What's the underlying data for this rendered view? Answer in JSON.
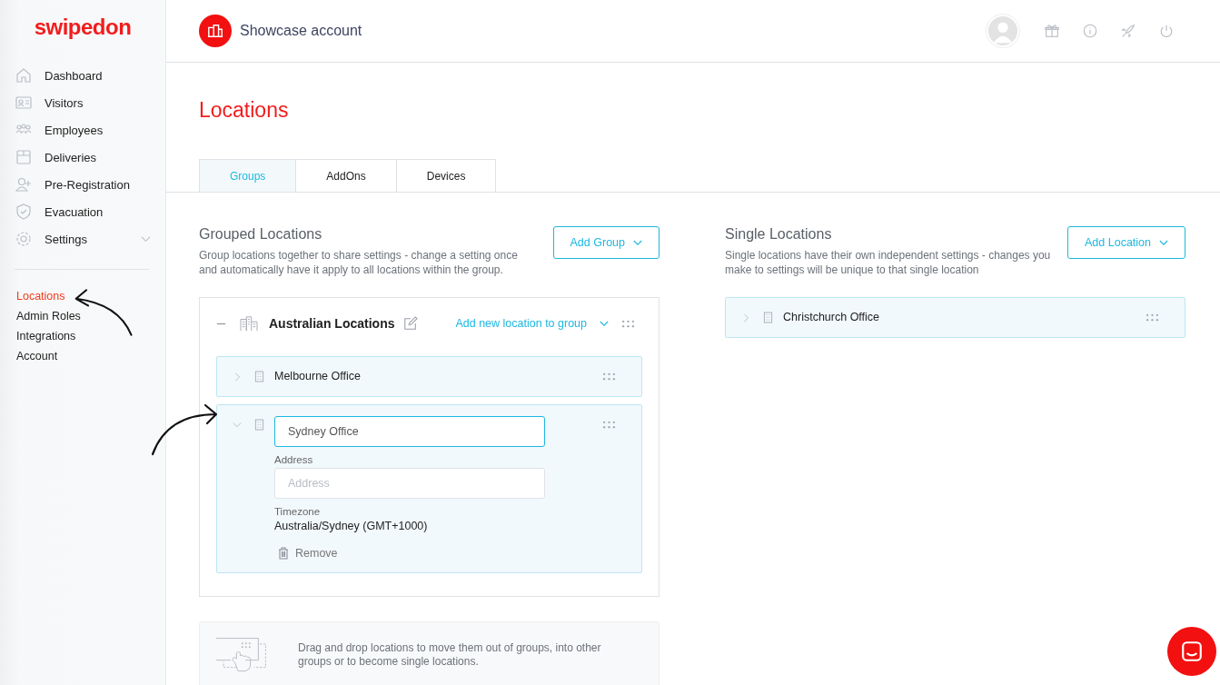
{
  "logo": "swipedon",
  "nav": [
    {
      "label": "Dashboard",
      "has_submenu": false
    },
    {
      "label": "Visitors",
      "has_submenu": false
    },
    {
      "label": "Employees",
      "has_submenu": false
    },
    {
      "label": "Deliveries",
      "has_submenu": false
    },
    {
      "label": "Pre-Registration",
      "has_submenu": false
    },
    {
      "label": "Evacuation",
      "has_submenu": false
    },
    {
      "label": "Settings",
      "has_submenu": true
    }
  ],
  "subnav": [
    {
      "label": "Locations",
      "selected": true
    },
    {
      "label": "Admin Roles",
      "selected": false
    },
    {
      "label": "Integrations",
      "selected": false
    },
    {
      "label": "Account",
      "selected": false
    }
  ],
  "header": {
    "account": "Showcase account"
  },
  "page_title": "Locations",
  "tabs": [
    {
      "label": "Groups",
      "selected": true
    },
    {
      "label": "AddOns",
      "selected": false
    },
    {
      "label": "Devices",
      "selected": false
    }
  ],
  "grouped": {
    "title": "Grouped Locations",
    "description": "Group locations together to share settings - change a setting once and automatically have it apply to all locations within the group.",
    "button": "Add Group",
    "groups": [
      {
        "name": "Australian Locations",
        "expanded": true,
        "add_link": "Add new location to group",
        "locations": [
          {
            "name": "Melbourne Office",
            "expanded": false
          },
          {
            "name": "Sydney Office",
            "expanded": true,
            "address_label": "Address",
            "address_placeholder": "Address",
            "timezone_label": "Timezone",
            "timezone": "Australia/Sydney (GMT+1000)",
            "remove": "Remove"
          }
        ]
      }
    ],
    "hint": "Drag and drop locations to move them out of groups, into other groups or to become single locations."
  },
  "single": {
    "title": "Single Locations",
    "description": "Single locations have their own independent settings - changes you make to settings will be unique to that single location",
    "button": "Add Location",
    "locations": [
      {
        "name": "Christchurch Office",
        "expanded": false
      }
    ]
  }
}
